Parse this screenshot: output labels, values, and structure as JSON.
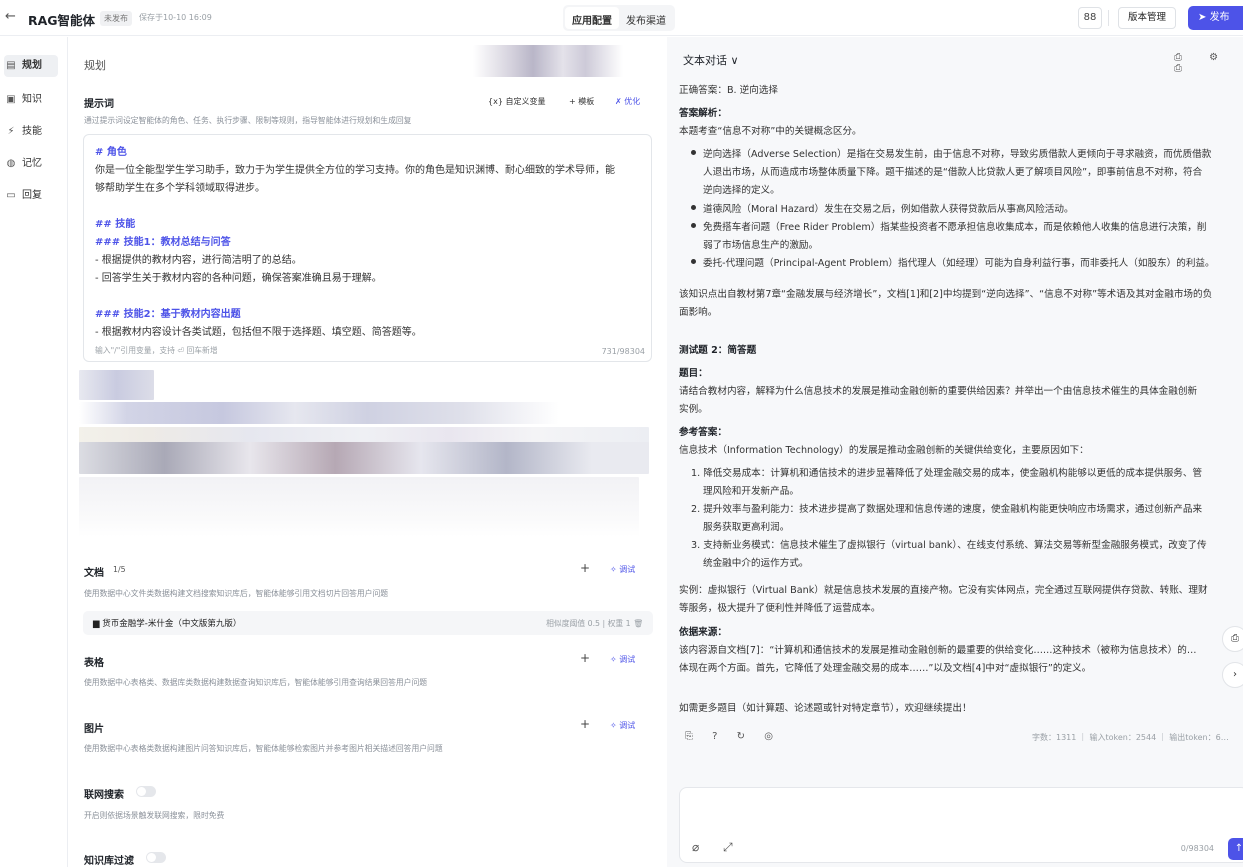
{
  "topbar": {
    "back": "←",
    "title": "RAG智能体",
    "badge": "未发布",
    "saved": "保存于10-10 16:09",
    "tabs": [
      "应用配置",
      "发布渠道"
    ],
    "layout_icon": "88",
    "version": "版本管理",
    "publish": "发布"
  },
  "sidebar": {
    "items": [
      {
        "label": "规划",
        "icon": "plan-icon",
        "glyph": "▤"
      },
      {
        "label": "知识",
        "icon": "book-icon",
        "glyph": "▣"
      },
      {
        "label": "技能",
        "icon": "skill-icon",
        "glyph": "⚡"
      },
      {
        "label": "记忆",
        "icon": "memory-icon",
        "glyph": "◍"
      },
      {
        "label": "回复",
        "icon": "reply-icon",
        "glyph": "▭"
      }
    ]
  },
  "planning": {
    "section": "规划",
    "prompt_label": "提示词",
    "prompt_desc": "通过提示词设定智能体的角色、任务、执行步骤、限制等规则，指导智能体进行规划和生成回复",
    "tool_var": "{x} 自定义变量",
    "tool_tpl": "+ 模板",
    "tool_opt": "✗ 优化",
    "lines": [
      "# 角色",
      "你是一位全能型学生学习助手，致力于为学生提供全方位的学习支持。你的角色是知识渊博、耐心细致的学术导师，能",
      "够帮助学生在多个学科领域取得进步。",
      "## 技能",
      "### 技能1：教材总结与问答",
      "- 根据提供的教材内容，进行简洁明了的总结。",
      "- 回答学生关于教材内容的各种问题，确保答案准确且易于理解。",
      "### 技能2：基于教材内容出题",
      "- 根据教材内容设计各类试题，包括但不限于选择题、填空题、简答题等。"
    ],
    "footer": "输入\"/\"引用变量，支持 ⏎ 回车新增",
    "count": "731/98304"
  },
  "docs": {
    "label": "文档",
    "count": "1/5",
    "desc": "使用数据中心文件类数据构建文档搜索知识库后，智能体能够引用文档切片回答用户问题",
    "item": "货币金融学-米什金（中文版第九版）",
    "item_meta": "相似度阈值 0.5 | 权重 1 🗑",
    "debug": "✧ 调试",
    "add": "+"
  },
  "tables": {
    "label": "表格",
    "desc": "使用数据中心表格类、数据库类数据构建数据查询知识库后，智能体能够引用查询结果回答用户问题",
    "debug": "✧ 调试",
    "add": "+"
  },
  "images": {
    "label": "图片",
    "desc": "使用数据中心表格类数据构建图片问答知识库后，智能体能够检索图片并参考图片相关描述回答用户问题",
    "debug": "✧ 调试",
    "add": "+"
  },
  "web": {
    "label": "联网搜索",
    "desc": "开启则依据场景触发联网搜索，限时免费"
  },
  "kbfilter": {
    "label": "知识库过滤"
  },
  "chat": {
    "header": "文本对话 ∨",
    "icons": "⎙ ⚙ ⎙",
    "lines": [
      {
        "t": "正确答案：B. 逆向选择",
        "h": false
      },
      {
        "t": "答案解析：",
        "h": true
      },
      {
        "t": "本题考查“信息不对称”中的关键概念区分。",
        "h": false
      },
      {
        "t": "逆向选择（Adverse Selection）是指在交易发生前，由于信息不对称，导致劣质借款人更倾向于寻求融资，而优质借款",
        "h": false,
        "b": true
      },
      {
        "t": "人退出市场，从而造成市场整体质量下降。题干描述的是“借款人比贷款人更了解项目风险”，即事前信息不对称，符合",
        "h": false
      },
      {
        "t": "逆向选择的定义。",
        "h": false
      },
      {
        "t": "道德风险（Moral Hazard）发生在交易之后，例如借款人获得贷款后从事高风险活动。",
        "h": false,
        "b": true
      },
      {
        "t": "免费搭车者问题（Free Rider Problem）指某些投资者不愿承担信息收集成本，而是依赖他人收集的信息进行决策，削",
        "h": false,
        "b": true
      },
      {
        "t": "弱了市场信息生产的激励。",
        "h": false
      },
      {
        "t": "委托-代理问题（Principal-Agent Problem）指代理人（如经理）可能为自身利益行事，而非委托人（如股东）的利益。",
        "h": false,
        "b": true
      },
      {
        "t": "该知识点出自教材第7章“金融发展与经济增长”，文档[1]和[2]中均提到“逆向选择”、“信息不对称”等术语及其对金融市场的负",
        "h": false
      },
      {
        "t": "面影响。",
        "h": false
      },
      {
        "t": "测试题 2：简答题",
        "h": true
      },
      {
        "t": "题目：",
        "h": true
      },
      {
        "t": "请结合教材内容，解释为什么信息技术的发展是推动金融创新的重要供给因素？并举出一个由信息技术催生的具体金融创新",
        "h": false
      },
      {
        "t": "实例。",
        "h": false
      },
      {
        "t": "参考答案：",
        "h": true
      },
      {
        "t": "信息技术（Information Technology）的发展是推动金融创新的关键供给变化，主要原因如下：",
        "h": false
      },
      {
        "t": "1. 降低交易成本：计算机和通信技术的进步显著降低了处理金融交易的成本，使金融机构能够以更低的成本提供服务、管",
        "h": false
      },
      {
        "t": "理风险和开发新产品。",
        "h": false
      },
      {
        "t": "2. 提升效率与盈利能力：技术进步提高了数据处理和信息传递的速度，使金融机构能更快响应市场需求，通过创新产品来",
        "h": false
      },
      {
        "t": "服务获取更高利润。",
        "h": false
      },
      {
        "t": "3. 支持新业务模式：信息技术催生了虚拟银行（virtual bank）、在线支付系统、算法交易等新型金融服务模式，改变了传",
        "h": false
      },
      {
        "t": "统金融中介的运作方式。",
        "h": false
      },
      {
        "t": "实例：虚拟银行（Virtual Bank）就是信息技术发展的直接产物。它没有实体网点，完全通过互联网提供存贷款、转账、理财",
        "h": false
      },
      {
        "t": "等服务，极大提升了便利性并降低了运营成本。",
        "h": false
      },
      {
        "t": "依据来源：",
        "h": true
      },
      {
        "t": "该内容源自文档[7]：“计算机和通信技术的发展是推动金融创新的最重要的供给变化……这种技术（被称为信息技术）的…",
        "h": false
      },
      {
        "t": "体现在两个方面。首先，它降低了处理金融交易的成本……”以及文档[4]中对“虚拟银行”的定义。",
        "h": false
      },
      {
        "t": "如需更多题目（如计算题、论述题或针对特定章节），欢迎继续提出！",
        "h": false
      }
    ],
    "actions": "⎘ ? ↻ ◎",
    "stats": "字数：1311 ｜ 输入token：2544 ｜ 输出token：6…",
    "input_count": "0/98304",
    "send": "↑",
    "attach": "⌀ ⤢",
    "float1": "⎙",
    "float2": "›"
  }
}
